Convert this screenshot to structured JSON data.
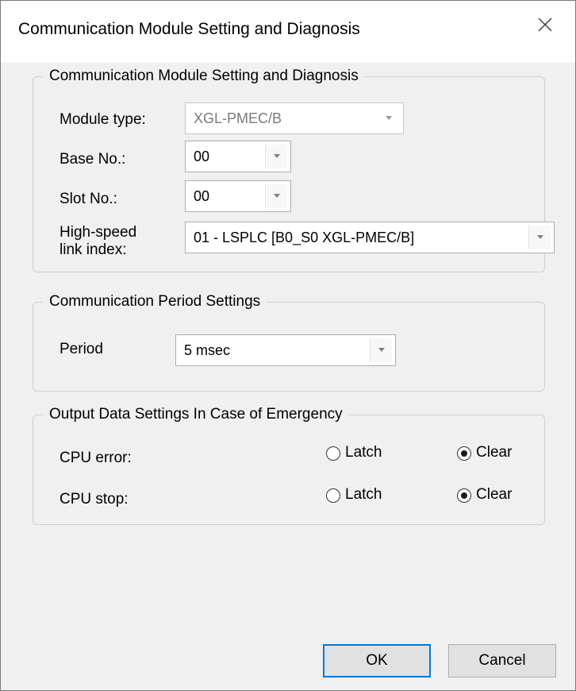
{
  "window": {
    "title": "Communication Module Setting and Diagnosis"
  },
  "module_group": {
    "legend": "Communication Module Setting and Diagnosis",
    "module_type_label": "Module type:",
    "module_type_value": "XGL-PMEC/B",
    "base_label": "Base No.:",
    "base_value": "00",
    "slot_label": "Slot No.:",
    "slot_value": "00",
    "link_label_line1": "High-speed",
    "link_label_line2": "link index:",
    "link_value": "01 - LSPLC [B0_S0 XGL-PMEC/B]"
  },
  "period_group": {
    "legend": "Communication Period Settings",
    "period_label": "Period",
    "period_value": "5 msec"
  },
  "emergency_group": {
    "legend": "Output Data Settings In Case of Emergency",
    "cpu_error_label": "CPU error:",
    "cpu_stop_label": "CPU stop:",
    "latch_label": "Latch",
    "clear_label": "Clear",
    "cpu_error_selected": "Clear",
    "cpu_stop_selected": "Clear"
  },
  "buttons": {
    "ok": "OK",
    "cancel": "Cancel"
  },
  "colors": {
    "dialog_bg": "#f0f0f0",
    "titlebar_bg": "#ffffff",
    "default_button_border": "#0078d7"
  },
  "icons": {
    "close": "close-icon",
    "dropdown": "chevron-down-icon",
    "radio": "radio-icon"
  }
}
